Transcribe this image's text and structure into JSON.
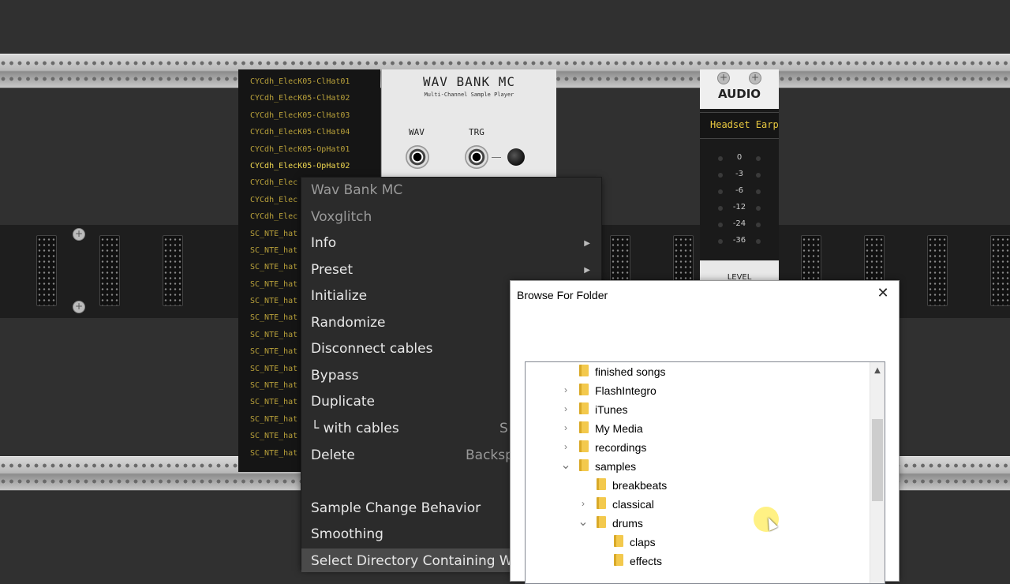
{
  "sample_list": {
    "items": [
      "CYCdh_ElecK05-ClHat01",
      "CYCdh_ElecK05-ClHat02",
      "CYCdh_ElecK05-ClHat03",
      "CYCdh_ElecK05-ClHat04",
      "CYCdh_ElecK05-OpHat01",
      "CYCdh_ElecK05-OpHat02",
      "CYCdh_Elec",
      "CYCdh_Elec",
      "CYCdh_Elec",
      "SC_NTE_hat",
      "SC_NTE_hat",
      "SC_NTE_hat",
      "SC_NTE_hat",
      "SC_NTE_hat",
      "SC_NTE_hat",
      "SC_NTE_hat",
      "SC_NTE_hat",
      "SC_NTE_hat",
      "SC_NTE_hat",
      "SC_NTE_hat",
      "SC_NTE_hat",
      "SC_NTE_hat",
      "SC_NTE_hat"
    ],
    "selected_index": 5
  },
  "wav_bank": {
    "title": "WAV BANK MC",
    "subtitle": "Multi-Channel Sample Player",
    "wav_label": "WAV",
    "trg_label": "TRG"
  },
  "audio_module": {
    "title": "AUDIO",
    "device": "Headset Earp",
    "vu_levels": [
      "0",
      "-3",
      "-6",
      "-12",
      "-24",
      "-36"
    ],
    "level_label": "LEVEL"
  },
  "context_menu": {
    "header_module": "Wav Bank MC",
    "header_brand": "Voxglitch",
    "items": {
      "info": "Info",
      "preset": "Preset",
      "initialize": "Initialize",
      "randomize": "Randomize",
      "disconnect": "Disconnect cables",
      "bypass": "Bypass",
      "duplicate": "Duplicate",
      "with_cables": "└ with cables",
      "delete": "Delete",
      "sample_change": "Sample Change Behavior",
      "smoothing": "Smoothing",
      "select_dir": "Select Directory Containing W"
    },
    "shortcuts": {
      "with_cables": "S",
      "delete": "Backsp"
    }
  },
  "dialog": {
    "title": "Browse For Folder",
    "close": "✕",
    "tree": [
      {
        "label": "finished songs",
        "chevron": "",
        "level": 0
      },
      {
        "label": "FlashIntegro",
        "chevron": "›",
        "level": 0
      },
      {
        "label": "iTunes",
        "chevron": "›",
        "level": 0
      },
      {
        "label": "My Media",
        "chevron": "›",
        "level": 0
      },
      {
        "label": "recordings",
        "chevron": "›",
        "level": 0
      },
      {
        "label": "samples",
        "chevron": "⌄",
        "level": 0
      },
      {
        "label": "breakbeats",
        "chevron": "",
        "level": 1
      },
      {
        "label": "classical",
        "chevron": "›",
        "level": 1
      },
      {
        "label": "drums",
        "chevron": "⌄",
        "level": 1
      },
      {
        "label": "claps",
        "chevron": "",
        "level": 2
      },
      {
        "label": "effects",
        "chevron": "",
        "level": 2
      }
    ]
  }
}
